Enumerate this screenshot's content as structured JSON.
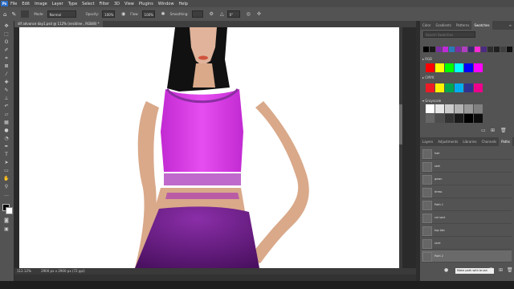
{
  "app": {
    "logo_text": "Ps"
  },
  "menu": [
    "File",
    "Edit",
    "Image",
    "Layer",
    "Type",
    "Select",
    "Filter",
    "3D",
    "View",
    "Plugins",
    "Window",
    "Help"
  ],
  "options": {
    "mode_label": "Mode:",
    "mode_value": "Normal",
    "opacity_label": "Opacity:",
    "opacity_value": "100%",
    "flow_label": "Flow:",
    "flow_value": "100%",
    "smoothing_label": "Smoothing:",
    "smoothing_value": "",
    "angle_value": "0°"
  },
  "document": {
    "tab_title": "dif advance day1.psd @ 112% (neckline , RGB/8) *"
  },
  "status": {
    "zoom": "112.12%",
    "doc_size": "2900 px x 2900 px (72 ppi)"
  },
  "swatches": {
    "tabs": [
      "Color",
      "Gradients",
      "Patterns",
      "Swatches"
    ],
    "active_tab": "Swatches",
    "search_placeholder": "Search Swatches",
    "recent": [
      "#000000",
      "#1a1a1a",
      "#7a2ea0",
      "#c02ad6",
      "#2a7ab8",
      "#7a2ea0",
      "#b03fc0",
      "#3a2a70",
      "#ff2ad6",
      "#4b2a80",
      "#2d2d2d",
      "#202020",
      "#404040",
      "#101010"
    ],
    "groups": [
      {
        "name": "RGB",
        "colors": [
          "#ff0000",
          "#ffff00",
          "#00ff00",
          "#00ffff",
          "#0000ff",
          "#ff00ff"
        ]
      },
      {
        "name": "CMYK",
        "colors": [
          "#ed1c24",
          "#fff200",
          "#00a651",
          "#00aeef",
          "#2e3192",
          "#ec008c"
        ]
      },
      {
        "name": "Grayscale",
        "colors": [
          "#ffffff",
          "#e6e6e6",
          "#cccccc",
          "#b3b3b3",
          "#999999",
          "#808080",
          "#666666",
          "#4d4d4d",
          "#333333",
          "#1a1a1a",
          "#000000",
          "#0d0d0d"
        ]
      }
    ]
  },
  "paths": {
    "tabs": [
      "Layers",
      "Adjustments",
      "Libraries",
      "Channels",
      "Paths"
    ],
    "active_tab": "Paths",
    "items": [
      "hair",
      "skel",
      "gown",
      "dress",
      "Path 1",
      "col sect",
      "top tab",
      "skirt",
      "Path 2"
    ],
    "selected_index": 8,
    "tooltip": "Make path with brush"
  },
  "colors": {
    "top_main": "#c22ad2",
    "top_band": "#a52ab8",
    "skirt": "#4a1060",
    "skin": "#d9a98a"
  }
}
